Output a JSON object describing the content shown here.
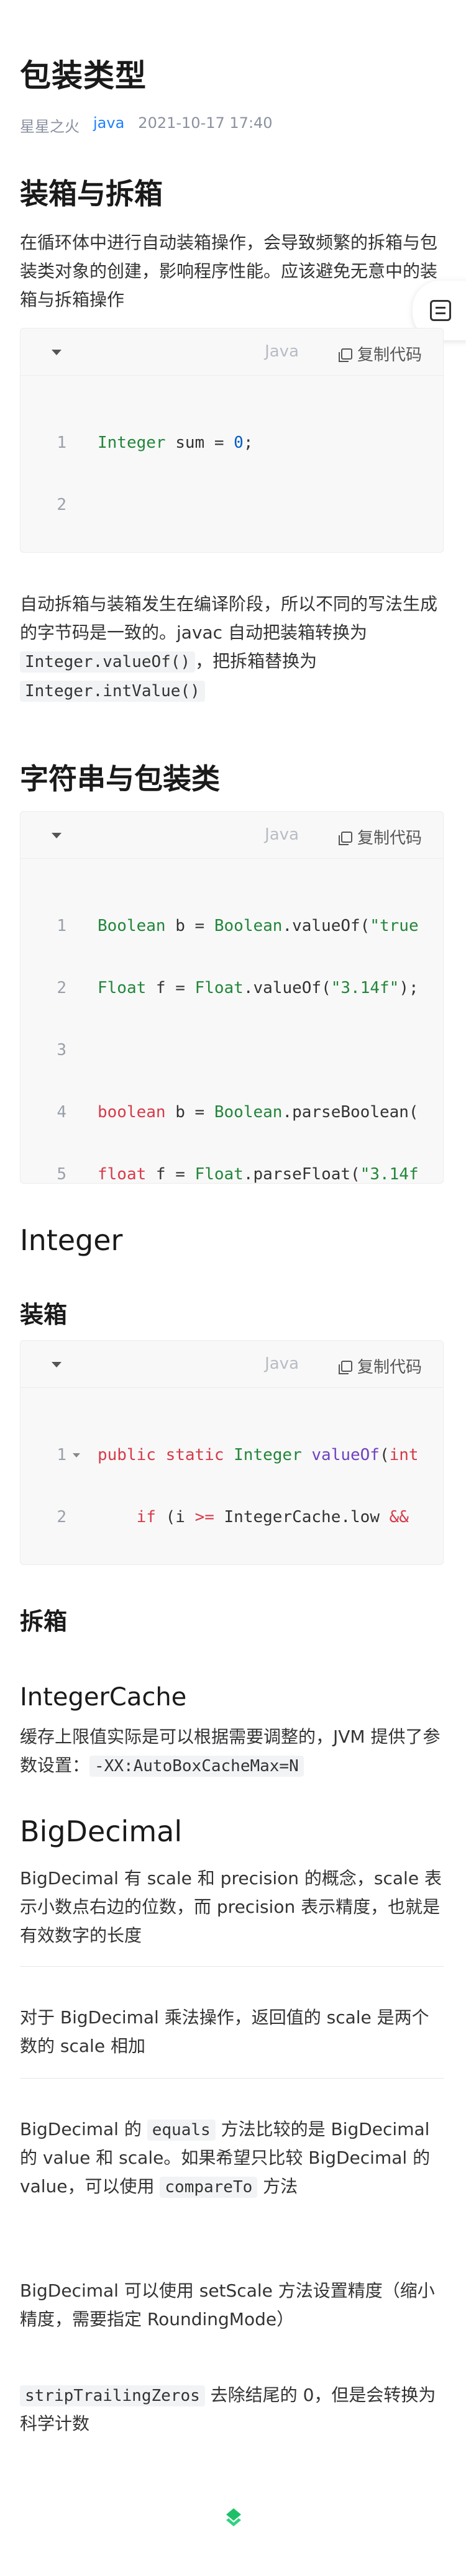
{
  "title": "包装类型",
  "meta": {
    "author": "星星之火",
    "tag": "java",
    "date": "2021-10-17 17:40"
  },
  "sections": {
    "boxing": {
      "heading": "装箱与拆箱",
      "para1": "在循环体中进行自动装箱操作，会导致频繁的拆箱与包装类对象的创建，影响程序性能。应该避免无意中的装箱与拆箱操作",
      "para2_a": "自动拆箱与装箱发生在编译阶段，所以不同的写法生成的字节码是一致的。javac 自动把装箱转换为 ",
      "para2_code1": "Integer.valueOf()",
      "para2_b": "，把拆箱替换为 ",
      "para2_code2": "Integer.intValue()"
    },
    "string": {
      "heading": "字符串与包装类"
    },
    "integer": {
      "heading": "Integer",
      "sub_boxing": "装箱",
      "sub_unboxing": "拆箱",
      "sub_cache": "IntegerCache",
      "cache_para_a": "缓存上限值实际是可以根据需要调整的，JVM 提供了参数设置：",
      "cache_code": "-XX:AutoBoxCacheMax=N"
    },
    "bigdecimal": {
      "heading": "BigDecimal",
      "p1": "BigDecimal 有 scale 和 precision 的概念，scale 表示小数点右边的位数，而 precision 表示精度，也就是有效数字的长度",
      "p2": "对于 BigDecimal 乘法操作，返回值的 scale 是两个数的 scale 相加",
      "p3_a": "BigDecimal 的 ",
      "p3_code1": "equals",
      "p3_b": " 方法比较的是 BigDecimal 的 value 和 scale。如果希望只比较 BigDecimal 的 value，可以使用 ",
      "p3_code2": "compareTo",
      "p3_c": " 方法",
      "p4": "BigDecimal 可以使用 setScale 方法设置精度（缩小精度，需要指定 RoundingMode）",
      "p5_code": "stripTrailingZeros",
      "p5_b": " 去除结尾的 0，但是会转换为科学计数"
    }
  },
  "code": {
    "lang": "Java",
    "copy_label": "复制代码"
  },
  "colors": {
    "accent": "#1e80ff",
    "keyword": "#d73a49",
    "type": "#22863a",
    "number": "#005cc5"
  },
  "icons": {
    "toc": "toc-icon",
    "copy": "copy-icon",
    "collapse": "chevron-down-icon",
    "logo": "juejin-logo-icon"
  }
}
